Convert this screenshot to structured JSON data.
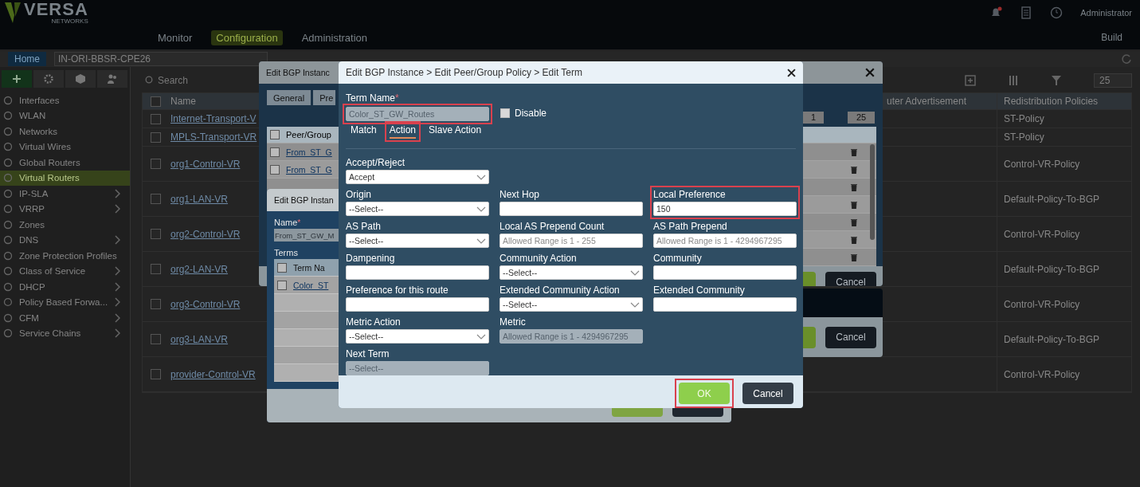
{
  "header": {
    "logo": "VERSA",
    "logo_sub": "NETWORKS",
    "alert": true,
    "user": "Administrator",
    "mode": "Build",
    "nav": [
      {
        "label": "Monitor",
        "selected": false
      },
      {
        "label": "Configuration",
        "selected": true
      },
      {
        "label": "Administration",
        "selected": false
      }
    ]
  },
  "breadcrumb": {
    "home": "Home",
    "device": "IN-ORI-BBSR-CPE26"
  },
  "sidebar": {
    "tools": [
      {
        "kind": "plus",
        "selected": true
      },
      {
        "kind": "gear",
        "selected": false
      },
      {
        "kind": "cube",
        "selected": false
      },
      {
        "kind": "people",
        "selected": false
      }
    ],
    "items": [
      {
        "label": "Interfaces",
        "expandable": false,
        "selected": false
      },
      {
        "label": "WLAN",
        "expandable": false,
        "selected": false
      },
      {
        "label": "Networks",
        "expandable": false,
        "selected": false
      },
      {
        "label": "Virtual Wires",
        "expandable": false,
        "selected": false
      },
      {
        "label": "Global Routers",
        "expandable": false,
        "selected": false
      },
      {
        "label": "Virtual Routers",
        "expandable": false,
        "selected": true
      },
      {
        "label": "IP-SLA",
        "expandable": true,
        "selected": false
      },
      {
        "label": "VRRP",
        "expandable": true,
        "selected": false
      },
      {
        "label": "Zones",
        "expandable": false,
        "selected": false
      },
      {
        "label": "DNS",
        "expandable": true,
        "selected": false
      },
      {
        "label": "Zone Protection Profiles",
        "expandable": false,
        "selected": false
      },
      {
        "label": "Class of Service",
        "expandable": true,
        "selected": false
      },
      {
        "label": "DHCP",
        "expandable": true,
        "selected": false
      },
      {
        "label": "Policy Based Forwa...",
        "expandable": true,
        "selected": false
      },
      {
        "label": "CFM",
        "expandable": true,
        "selected": false
      },
      {
        "label": "Service Chains",
        "expandable": true,
        "selected": false
      }
    ]
  },
  "table": {
    "search_placeholder": "Search",
    "page_size": "25",
    "header_checked": false,
    "columns": [
      "Name",
      "uter Advertisement",
      "Redistribution Policies"
    ],
    "rows": [
      {
        "name": "Internet-Transport-V",
        "policy": "ST-Policy",
        "checked": false
      },
      {
        "name": "MPLS-Transport-VR",
        "policy": "ST-Policy",
        "checked": false
      },
      {
        "name": "org1-Control-VR",
        "policy": "Control-VR-Policy",
        "checked": false
      },
      {
        "name": "org1-LAN-VR",
        "policy": "Default-Policy-To-BGP",
        "checked": false
      },
      {
        "name": "org2-Control-VR",
        "policy": "Control-VR-Policy",
        "checked": false
      },
      {
        "name": "org2-LAN-VR",
        "policy": "Default-Policy-To-BGP",
        "checked": false
      },
      {
        "name": "org3-Control-VR",
        "policy": "Control-VR-Policy",
        "checked": false
      },
      {
        "name": "org3-LAN-VR",
        "policy": "Default-Policy-To-BGP",
        "checked": false
      },
      {
        "name": "provider-Control-VR",
        "policy": "Control-VR-Policy",
        "checked": false
      }
    ]
  },
  "peer_dialog": {
    "title": "Edit BGP Instanc",
    "tabs": [
      {
        "label": "General",
        "selected": false
      },
      {
        "label": "Pre",
        "selected": false
      }
    ],
    "column": "Peer/Group",
    "header_checked": false,
    "page": "1",
    "page_size": "25",
    "rows": [
      {
        "name": "From_ST_G",
        "checked": false,
        "deletable": true
      },
      {
        "name": "From_ST_G",
        "checked": false,
        "deletable": true
      },
      {
        "deletable": true
      },
      {
        "deletable": true
      },
      {
        "deletable": true
      },
      {
        "deletable": true
      },
      {
        "deletable": true
      }
    ],
    "buttons": [
      {
        "kind": "primary"
      },
      {
        "kind": "secondary",
        "label": "Cancel"
      }
    ]
  },
  "outer_footer": {
    "buttons": [
      {
        "kind": "primary"
      },
      {
        "kind": "secondary",
        "label": "Cancel"
      }
    ]
  },
  "policy_dialog": {
    "title": "Edit BGP Instan",
    "name_label": "Name",
    "name_required": true,
    "name_mark": "*",
    "name_value": "From_ST_GW_M",
    "terms_label": "Terms",
    "column": "Term Na",
    "header_checked": false,
    "rows": [
      {
        "name": "Color_ST",
        "checked": false
      }
    ],
    "buttons": [
      {
        "kind": "primary"
      },
      {
        "kind": "secondary"
      }
    ]
  },
  "term_dialog": {
    "title": "Edit BGP Instance > Edit Peer/Group Policy > Edit Term",
    "term_name": {
      "label": "Term Name",
      "required": true,
      "required_mark": "*",
      "value": "Color_ST_GW_Routes",
      "disabled": true,
      "highlighted": true
    },
    "disable": {
      "label": "Disable",
      "checked": false
    },
    "tabs": [
      {
        "label": "Match",
        "selected": false,
        "highlighted": false
      },
      {
        "label": "Action",
        "selected": true,
        "highlighted": true
      },
      {
        "label": "Slave Action",
        "selected": false,
        "highlighted": false
      }
    ],
    "rows": [
      [
        {
          "label": "Accept/Reject",
          "kind": "select",
          "value": "Accept",
          "disabled": false,
          "highlighted": false
        }
      ],
      [
        {
          "label": "Origin",
          "kind": "select",
          "value": "--Select--",
          "disabled": false,
          "highlighted": false
        },
        {
          "label": "Next Hop",
          "kind": "text",
          "disabled": false,
          "highlighted": false
        },
        {
          "label": "Local Preference",
          "kind": "text",
          "value": "150",
          "disabled": false,
          "highlighted": true
        }
      ],
      [
        {
          "label": "AS Path",
          "kind": "select",
          "value": "--Select--",
          "disabled": false,
          "highlighted": false
        },
        {
          "label": "Local AS Prepend Count",
          "kind": "text",
          "placeholder": "Allowed Range is 1 - 255",
          "disabled": false,
          "highlighted": false
        },
        {
          "label": "AS Path Prepend",
          "kind": "text",
          "placeholder": "Allowed Range is 1 - 4294967295",
          "disabled": false,
          "highlighted": false
        }
      ],
      [
        {
          "label": "Dampening",
          "kind": "text",
          "disabled": false,
          "highlighted": false
        },
        {
          "label": "Community Action",
          "kind": "select",
          "value": "--Select--",
          "disabled": false,
          "highlighted": false
        },
        {
          "label": "Community",
          "kind": "text",
          "disabled": false,
          "highlighted": false
        }
      ],
      [
        {
          "label": "Preference for this route",
          "kind": "text",
          "disabled": false,
          "highlighted": false
        },
        {
          "label": "Extended Community Action",
          "kind": "select",
          "value": "--Select--",
          "disabled": false,
          "highlighted": false
        },
        {
          "label": "Extended Community",
          "kind": "text",
          "disabled": false,
          "highlighted": false
        }
      ],
      [
        {
          "label": "Metric Action",
          "kind": "select",
          "value": "--Select--",
          "disabled": false,
          "highlighted": false
        },
        {
          "label": "Metric",
          "kind": "text",
          "placeholder": "Allowed Range is 1 - 4294967295",
          "disabled": true,
          "highlighted": false
        }
      ],
      [
        {
          "label": "Next Term",
          "kind": "select",
          "value": "--Select--",
          "disabled": true,
          "highlighted": false
        }
      ]
    ],
    "buttons": [
      {
        "label": "OK",
        "kind": "primary",
        "highlighted": true
      },
      {
        "label": "Cancel",
        "kind": "secondary",
        "highlighted": false
      }
    ]
  }
}
